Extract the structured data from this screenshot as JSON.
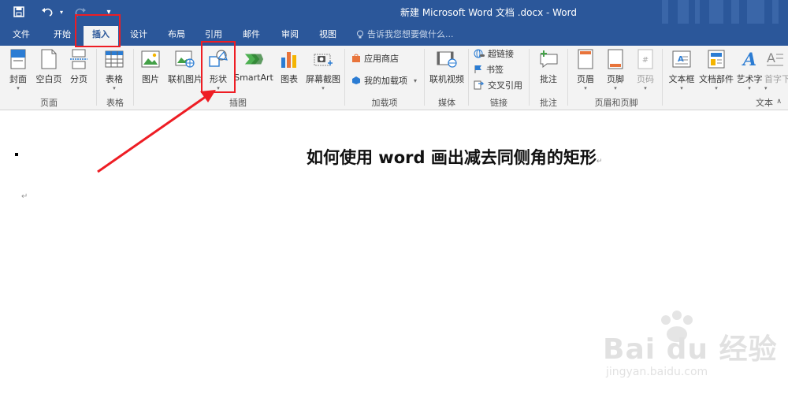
{
  "window": {
    "title": "新建 Microsoft Word 文档 .docx - Word",
    "qat": {
      "save": "save-icon",
      "undo": "undo-icon",
      "redo": "redo-icon",
      "customize": "customize-icon"
    }
  },
  "tabs": [
    {
      "label": "文件"
    },
    {
      "label": "开始"
    },
    {
      "label": "插入"
    },
    {
      "label": "设计"
    },
    {
      "label": "布局"
    },
    {
      "label": "引用"
    },
    {
      "label": "邮件"
    },
    {
      "label": "审阅"
    },
    {
      "label": "视图"
    }
  ],
  "active_tab": "插入",
  "tell_me": {
    "placeholder": "告诉我您想要做什么..."
  },
  "ribbon": {
    "pages": {
      "group_label": "页面",
      "cover": "封面",
      "blank_page": "空白页",
      "page_break": "分页"
    },
    "tables": {
      "group_label": "表格",
      "table": "表格"
    },
    "illustrations": {
      "group_label": "插图",
      "picture": "图片",
      "online_picture": "联机图片",
      "shapes": "形状",
      "smartart": "SmartArt",
      "chart": "图表",
      "screenshot": "屏幕截图"
    },
    "addins": {
      "group_label": "加载项",
      "store": "应用商店",
      "my_addins": "我的加载项"
    },
    "media": {
      "group_label": "媒体",
      "online_video": "联机视频"
    },
    "links": {
      "group_label": "链接",
      "hyperlink": "超链接",
      "bookmark": "书签",
      "cross_reference": "交叉引用"
    },
    "comments": {
      "group_label": "批注",
      "comment": "批注"
    },
    "header_footer": {
      "group_label": "页眉和页脚",
      "header": "页眉",
      "footer": "页脚",
      "page_number": "页码"
    },
    "text": {
      "group_label": "文本",
      "text_box": "文本框",
      "quick_parts": "文档部件",
      "wordart": "艺术字",
      "drop_cap": "首字下"
    }
  },
  "document": {
    "heading": "如何使用 word 画出减去同侧角的矩形",
    "paragraph_mark": "↵"
  },
  "colors": {
    "title_bar": "#2b579a",
    "ribbon_bg": "#f3f3f3",
    "highlight": "#ee1d24",
    "accent_orange": "#e8743b",
    "accent_blue": "#2b7cd3"
  },
  "watermark": {
    "brand": "Bai du 经验",
    "url": "jingyan.baidu.com"
  }
}
